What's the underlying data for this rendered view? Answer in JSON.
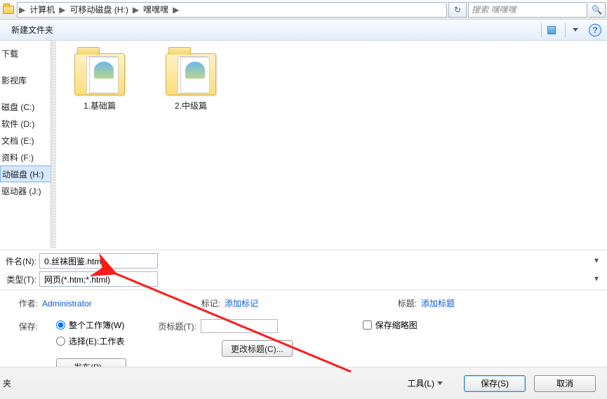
{
  "address": {
    "crumbs": [
      "计算机",
      "可移动磁盘 (H:)",
      "嘿嘿嘿"
    ],
    "search_placeholder": "搜索 嘿嘿嘿"
  },
  "toolbar": {
    "new_folder": "新建文件夹"
  },
  "sidebar": {
    "items": [
      "下载",
      "",
      "影视库",
      "",
      "磁盘 (C:)",
      "软件 (D:)",
      "文档 (E:)",
      "资料 (F:)",
      "动磁盘 (H:)",
      "驱动器 (J:)"
    ],
    "selected_index": 8
  },
  "folders": [
    {
      "label": "1.基础篇"
    },
    {
      "label": "2.中级篇"
    }
  ],
  "filename": {
    "label": "件名(N):",
    "value": "0.丝袜图鉴.htm"
  },
  "filetype": {
    "label": "类型(T):",
    "value": "网页(*.htm;*.html)"
  },
  "meta": {
    "author_key": "作者:",
    "author_value": "Administrator",
    "tags_key": "标记:",
    "tags_value": "添加标记",
    "title_key": "标题:",
    "title_value": "添加标题",
    "save_key": "保存:",
    "radio_whole": "整个工作簿(W)",
    "radio_selection": "选择(E):工作表",
    "page_title_key": "页标题(T):",
    "change_title_btn": "更改标题(C)...",
    "save_thumbnail": "保存缩略图",
    "publish_btn": "发布(P)..."
  },
  "bottom": {
    "left_label": "夹",
    "tools": "工具(L)",
    "save": "保存(S)",
    "cancel": "取消"
  }
}
